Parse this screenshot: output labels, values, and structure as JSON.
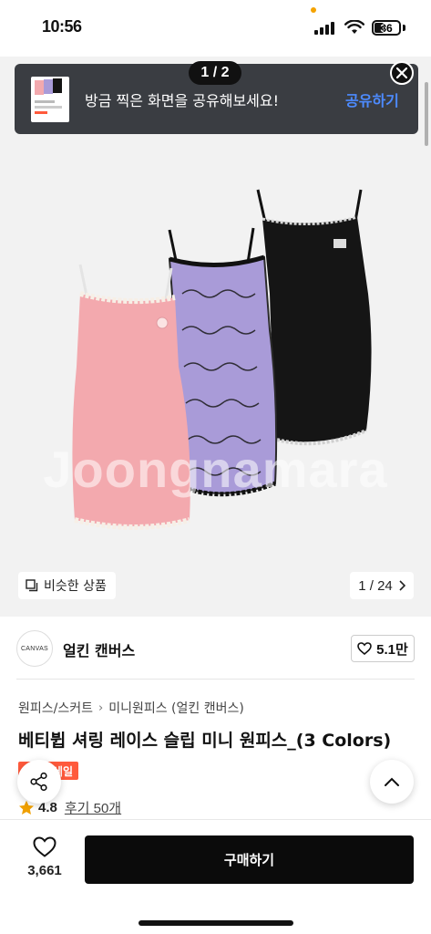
{
  "status_bar": {
    "time": "10:56",
    "battery": "36",
    "accent": "#f5a300"
  },
  "gallery": {
    "page_indicator": "1 / 2",
    "watermark": "Joongnamara",
    "share_toast": {
      "message": "방금 찍은 화면을 공유해보세요!",
      "action": "공유하기",
      "action_color": "#4d8bff"
    },
    "similar_label": "비슷한 상품",
    "image_counter": "1 / 24",
    "dress_colors": [
      "#f3a9ae",
      "#a99bd8",
      "#151515"
    ]
  },
  "seller": {
    "avatar_text": "CANVAS",
    "name": "얼킨 캔버스",
    "likes": "5.1만"
  },
  "breadcrumb": [
    "원피스/스커트",
    "미니원피스 (얼킨 캔버스)"
  ],
  "product": {
    "title": "베티뷥 셔링 레이스 슬립 미니 원피스_(3 Colors)",
    "badge": "세일",
    "rating": "4.8",
    "reviews": "후기 50개"
  },
  "bottom_bar": {
    "wish_count": "3,661",
    "buy_label": "구매하기"
  },
  "icons": [
    "signal-icon",
    "wifi-icon",
    "close-icon",
    "similar-icon",
    "chevron-right-icon",
    "heart-icon",
    "share-icon",
    "chevron-up-icon",
    "star-icon"
  ]
}
